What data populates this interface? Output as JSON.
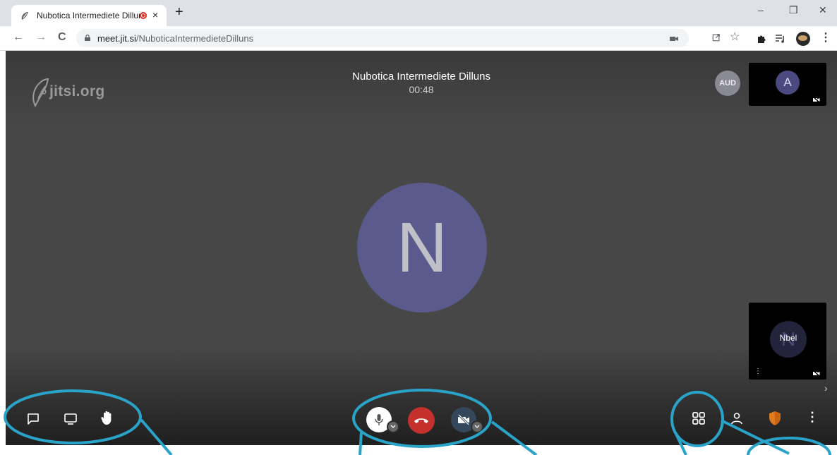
{
  "browser": {
    "tab_title": "Nubotica Intermediete Dillun",
    "tab_close": "×",
    "new_tab": "+",
    "window_minimize": "–",
    "window_restore": "❐",
    "window_close": "✕",
    "url_host": "meet.jit.si",
    "url_path": "/NuboticaIntermedieteDilluns",
    "nav_back": "←",
    "nav_forward": "→",
    "nav_reload": "C",
    "star": "☆",
    "menu": "⋮"
  },
  "meeting": {
    "logo_text": "jitsi.org",
    "title": "Nubotica Intermediete Dilluns",
    "timer": "00:48",
    "main_avatar_letter": "N",
    "audio_badge": "AUD",
    "thumb1_letter": "A",
    "thumb2_letter": "N",
    "thumb2_name": "Nbel",
    "overflow_dots": "⋮",
    "next_arrow": "›"
  },
  "toolbar": {
    "left_buttons": [
      "chat-icon",
      "screen-share-icon",
      "raise-hand-icon"
    ],
    "center_buttons": [
      "microphone-icon",
      "hangup-icon",
      "camera-off-icon"
    ],
    "right_buttons": [
      "tile-view-icon",
      "participants-icon",
      "security-shield-icon",
      "more-icon"
    ],
    "more_dots": "⋮"
  },
  "colors": {
    "meeting_background": "#474747",
    "avatar_main": "#5a5a8c",
    "hangup": "#c4302b",
    "shield": "#e07a1f",
    "annotation": "#2aa3c9"
  }
}
